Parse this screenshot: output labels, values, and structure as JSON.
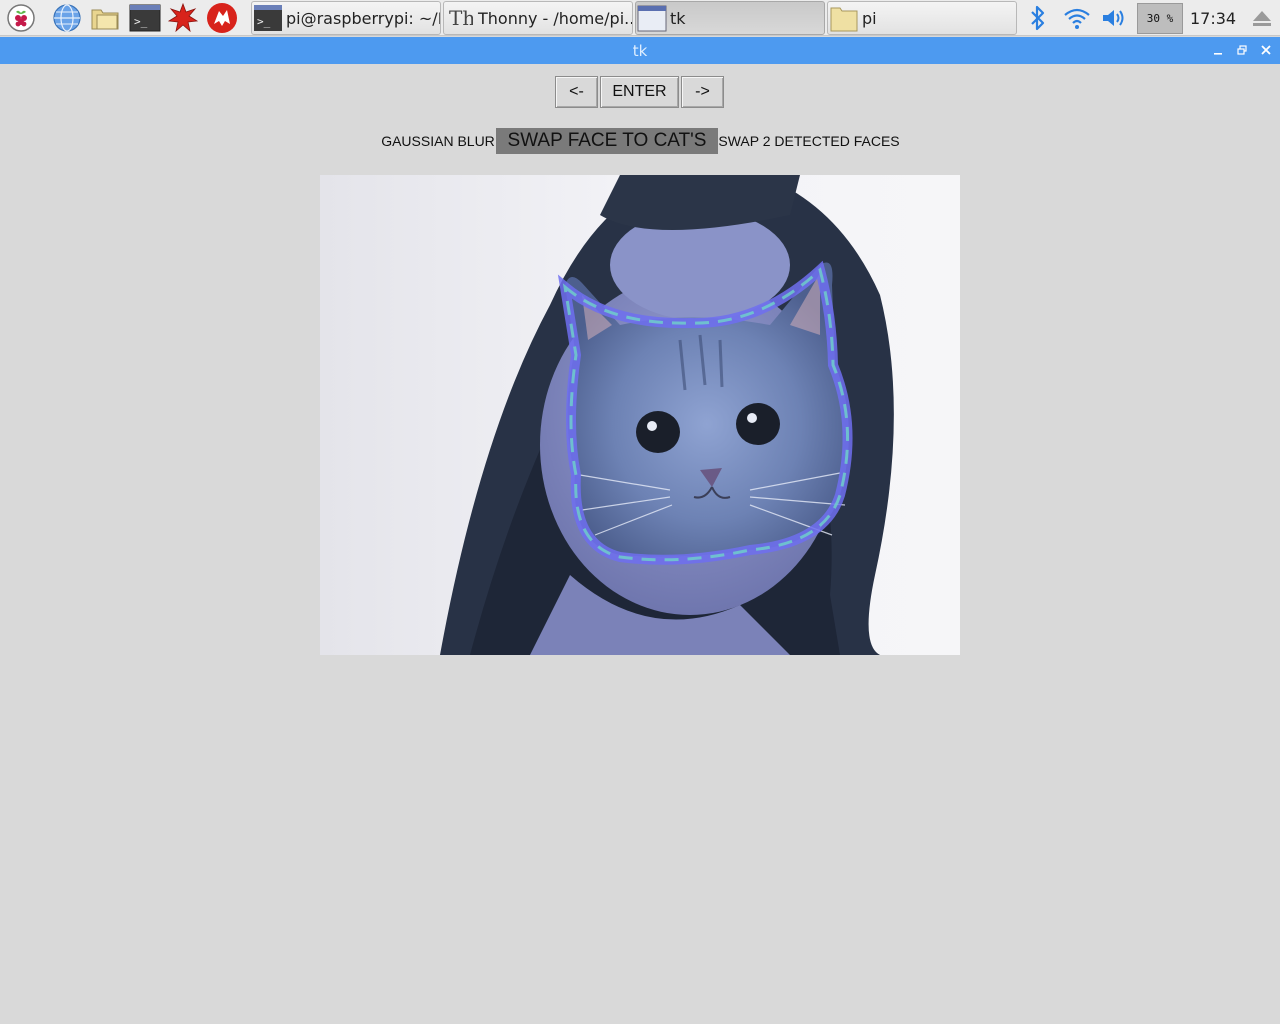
{
  "taskbar": {
    "launchers": [
      {
        "name": "raspberry-menu-icon"
      },
      {
        "name": "web-browser-icon"
      },
      {
        "name": "file-manager-icon"
      },
      {
        "name": "terminal-icon"
      },
      {
        "name": "mathematica-icon"
      },
      {
        "name": "wolfram-icon"
      }
    ],
    "tasks": [
      {
        "label": "pi@raspberrypi: ~/P...",
        "icon": "terminal-icon",
        "active": false
      },
      {
        "label": "Thonny  -  /home/pi...",
        "icon": "thonny-icon",
        "active": false
      },
      {
        "label": "tk",
        "icon": "window-icon",
        "active": true
      },
      {
        "label": "pi",
        "icon": "folder-icon",
        "active": false
      }
    ],
    "tray": {
      "battery_text": "30 %",
      "clock": "17:34",
      "icons": [
        "bluetooth-icon",
        "wifi-icon",
        "volume-icon",
        "eject-icon"
      ]
    }
  },
  "window": {
    "title": "tk",
    "controls": [
      "minimize-icon",
      "maximize-icon",
      "close-icon"
    ]
  },
  "app": {
    "nav": {
      "prev_label": "<-",
      "enter_label": "ENTER",
      "next_label": "->"
    },
    "filters": [
      {
        "label": "GAUSSIAN BLUR",
        "selected": false
      },
      {
        "label": "SWAP FACE TO CAT'S",
        "selected": true
      },
      {
        "label": "SWAP 2 DETECTED FACES",
        "selected": false
      }
    ]
  },
  "colors": {
    "desktop_bg": "#d9d9d9",
    "titlebar": "#4d9af0",
    "selected_filter": "#7a7a7a"
  }
}
